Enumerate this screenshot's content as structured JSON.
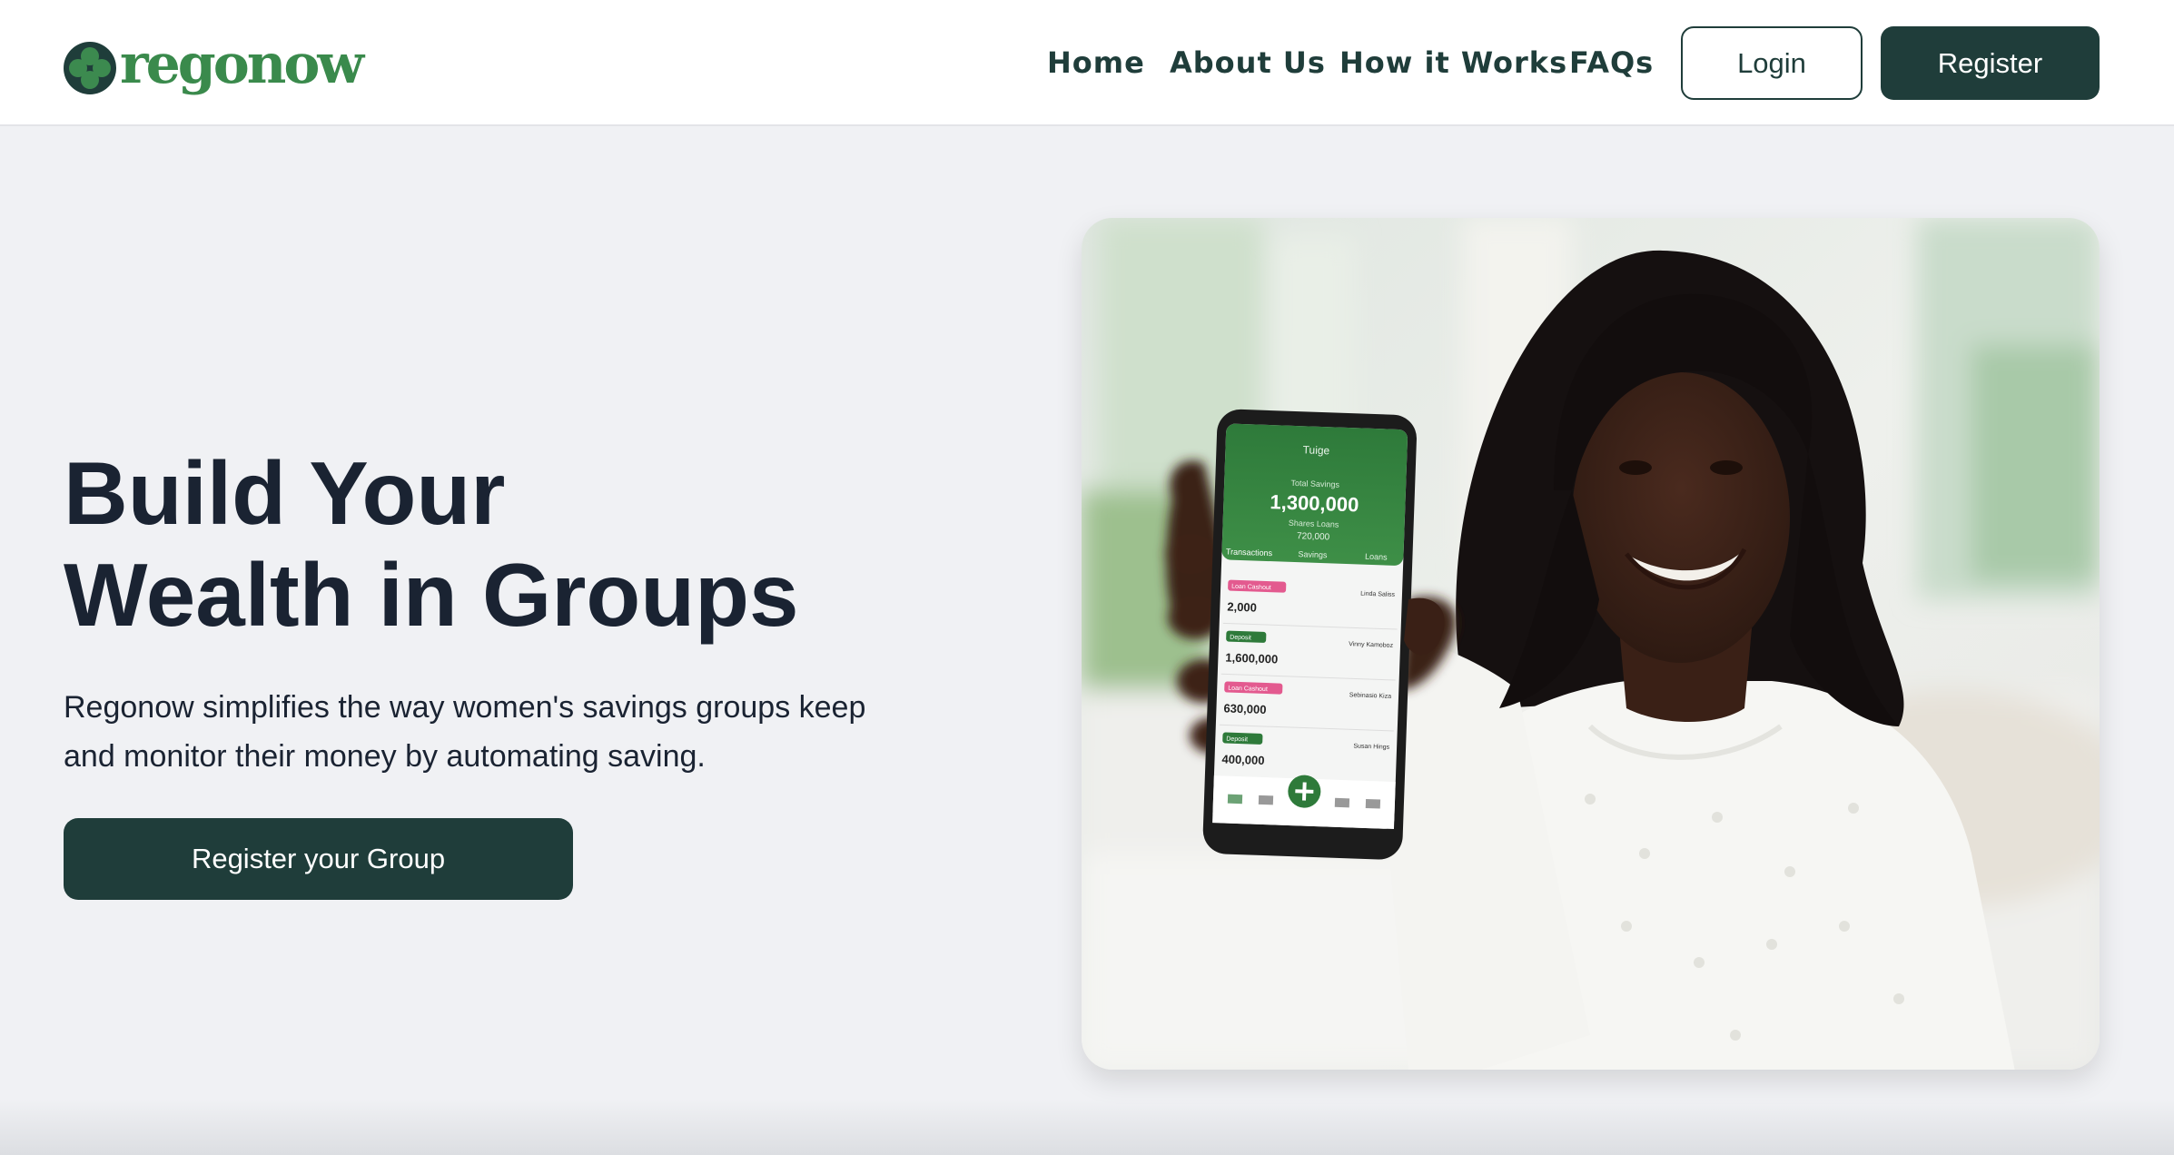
{
  "brand": {
    "name": "regonow",
    "primary_color": "#1f3d3a",
    "accent_color": "#3a8a4c"
  },
  "nav": {
    "items": [
      {
        "label": "Home"
      },
      {
        "label": "About Us"
      },
      {
        "label": "How it Works"
      },
      {
        "label": "FAQs"
      }
    ],
    "login_label": "Login",
    "register_label": "Register"
  },
  "hero": {
    "title_line1": "Build Your",
    "title_line2": "Wealth in Groups",
    "description_line1": "Regonow simplifies the way women's savings groups keep",
    "description_line2": "and monitor their money by automating saving.",
    "cta_label": "Register your Group"
  },
  "phone_screen": {
    "header_title": "Tuige",
    "total_label": "Total Savings",
    "total_value": "1,300,000",
    "sub_label": "Shares Loans",
    "sub_value": "720,000",
    "tabs": [
      "Transactions",
      "Savings",
      "Loans"
    ],
    "rows": [
      {
        "badge": "Loan Cashout",
        "amount": "2,000",
        "name": "Linda Saliss"
      },
      {
        "badge": "Deposit",
        "amount": "1,600,000",
        "name": "Vinny Kamoboz"
      },
      {
        "badge": "Loan Cashout",
        "amount": "630,000",
        "name": "Sebinasio Kiza"
      },
      {
        "badge": "Deposit",
        "amount": "400,000",
        "name": "Susan Hings"
      }
    ]
  }
}
